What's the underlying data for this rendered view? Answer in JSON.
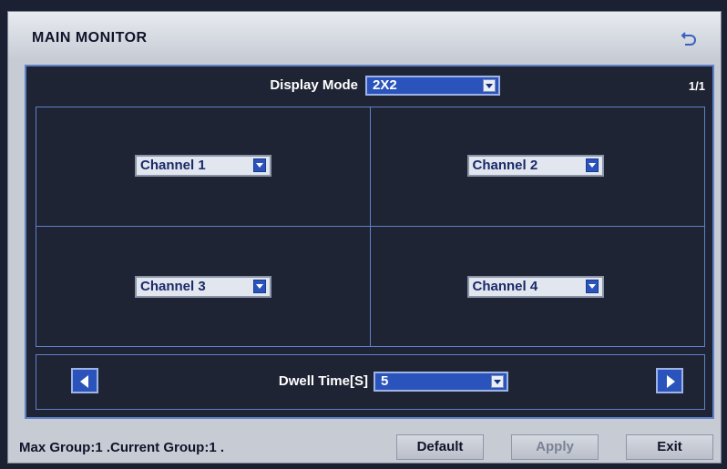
{
  "window": {
    "title": "MAIN MONITOR"
  },
  "display_mode": {
    "label": "Display Mode",
    "value": "2X2"
  },
  "page_indicator": "1/1",
  "channels": [
    {
      "value": "Channel 1"
    },
    {
      "value": "Channel 2"
    },
    {
      "value": "Channel 3"
    },
    {
      "value": "Channel 4"
    }
  ],
  "dwell": {
    "label": "Dwell Time[S]",
    "value": "5"
  },
  "status_text": "Max Group:1 .Current Group:1 .",
  "buttons": {
    "default": "Default",
    "apply": "Apply",
    "exit": "Exit"
  },
  "colors": {
    "accent": "#2a54bb",
    "panel": "#1f2434",
    "border": "#5f80c8"
  }
}
